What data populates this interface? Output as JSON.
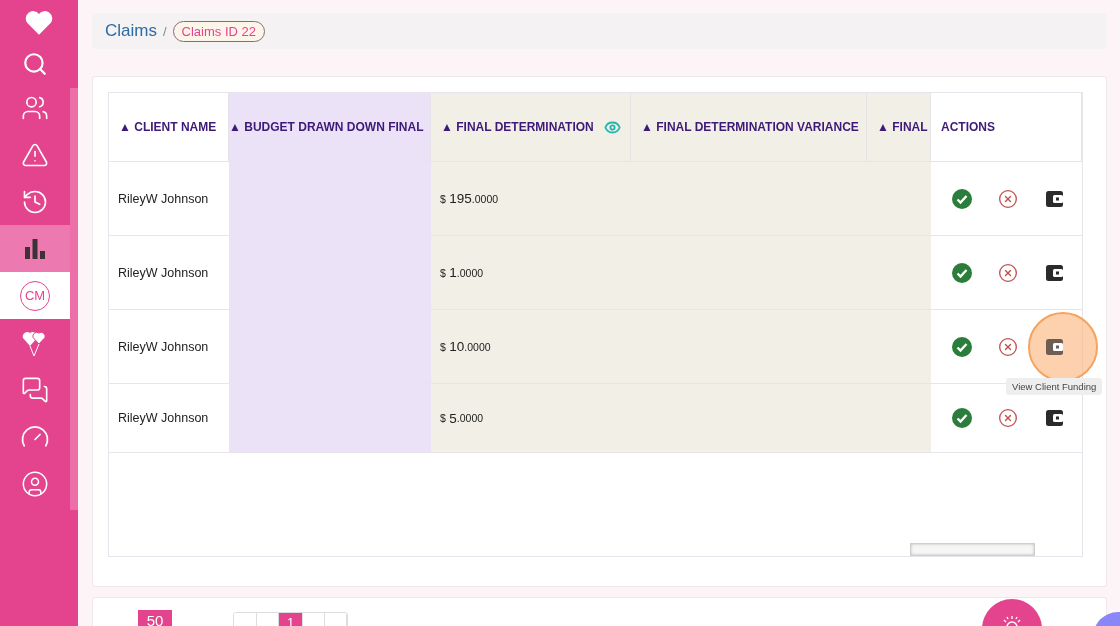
{
  "sidebar": {
    "items": [
      {
        "kind": "icon",
        "selected": false,
        "highlighted": false
      },
      {
        "kind": "icon",
        "selected": false,
        "highlighted": false
      },
      {
        "kind": "icon",
        "selected": false,
        "highlighted": false
      },
      {
        "kind": "icon",
        "selected": false,
        "highlighted": false
      },
      {
        "kind": "icon",
        "selected": true,
        "highlighted": false
      },
      {
        "kind": "badge",
        "label": "CM",
        "selected": false,
        "highlighted": true
      },
      {
        "kind": "icon",
        "selected": false,
        "highlighted": false
      },
      {
        "kind": "icon",
        "selected": false,
        "highlighted": false
      },
      {
        "kind": "icon",
        "selected": false,
        "highlighted": false
      },
      {
        "kind": "icon",
        "selected": false,
        "highlighted": false
      }
    ]
  },
  "breadcrumb": {
    "root": "Claims",
    "separator": "/",
    "current": "Claims ID 22"
  },
  "table": {
    "columns": [
      {
        "kind": "name",
        "label": "▲ CLIENT NAME",
        "visibility_toggle": false
      },
      {
        "kind": "budget",
        "label": "▲ BUDGET DRAWN DOWN FINAL",
        "visibility_toggle": false
      },
      {
        "kind": "amount",
        "label": "▲ FINAL DETERMINATION",
        "visibility_toggle": true
      },
      {
        "kind": "variance",
        "label": "▲ FINAL DETERMINATION VARIANCE",
        "visibility_toggle": false
      },
      {
        "kind": "cut",
        "label": "▲ FINAL",
        "visibility_toggle": false
      },
      {
        "kind": "actions",
        "label": "ACTIONS",
        "visibility_toggle": false
      }
    ],
    "rows": [
      {
        "client": "RileyW Johnson",
        "currency": "$",
        "whole": "195",
        "fraction": ".0000",
        "highlighted": false
      },
      {
        "client": "RileyW Johnson",
        "currency": "$",
        "whole": "1",
        "fraction": ".0000",
        "highlighted": false
      },
      {
        "client": "RileyW Johnson",
        "currency": "$",
        "whole": "10",
        "fraction": ".0000",
        "highlighted": true,
        "tooltip": "View Client Funding"
      },
      {
        "client": "RileyW Johnson",
        "currency": "$",
        "whole": "5",
        "fraction": ".0000",
        "highlighted": false
      }
    ]
  },
  "pager": {
    "page_size": "50",
    "pages": [
      {
        "label": "1",
        "selected": true
      }
    ]
  }
}
